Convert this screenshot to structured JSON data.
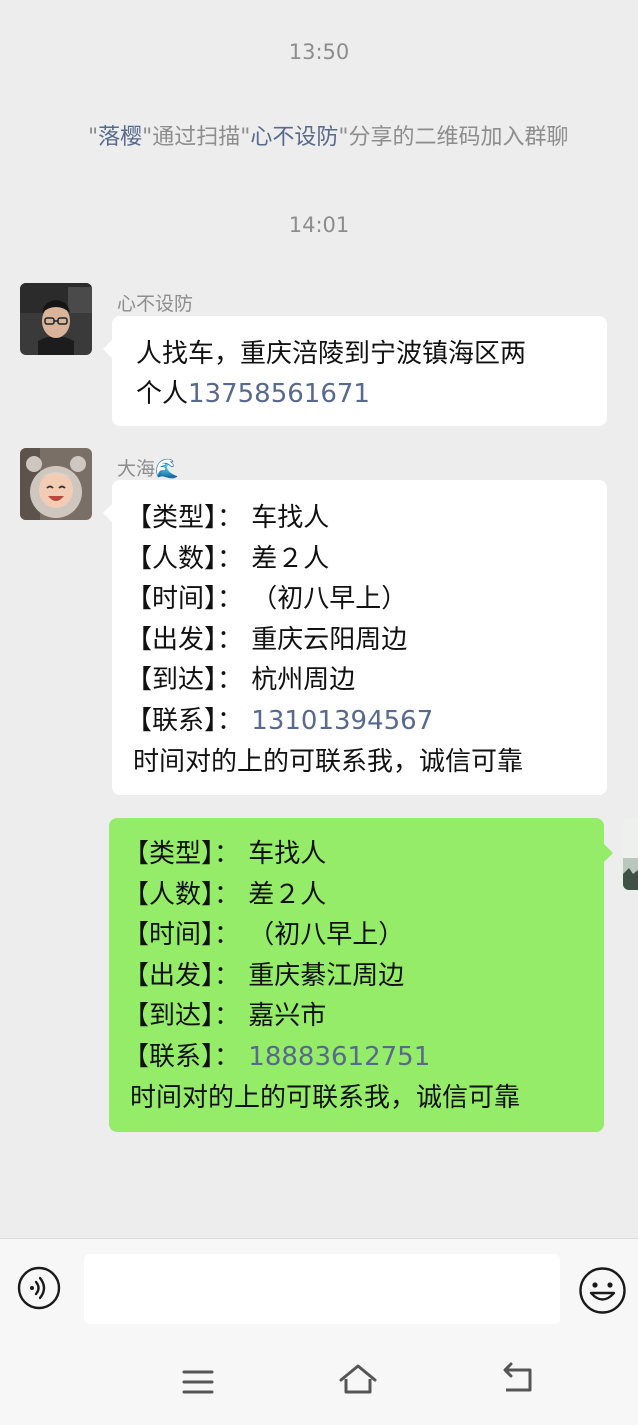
{
  "timestamps": [
    "13:50",
    "14:01"
  ],
  "system_message": {
    "q1": "\"",
    "name1": "落樱",
    "mid": "\"通过扫描\"",
    "name2": "心不设防",
    "tail": "\"分享的二维码加入群聊"
  },
  "messages": [
    {
      "sender": "心不设防",
      "avatar_icon": "man-avatar-photo",
      "line1": "人找车，重庆涪陵到宁波镇海区两",
      "line2_text": "个人",
      "phone": "13758561671"
    },
    {
      "sender": "大海🌊",
      "avatar_icon": "toddler-avatar-photo",
      "lines": [
        {
          "label": "【类型】：",
          "value": "车找人"
        },
        {
          "label": "【人数】：",
          "value": "差２人"
        },
        {
          "label": "【时间】：",
          "value": "（初八早上）"
        },
        {
          "label": "【出发】：",
          "value": "重庆云阳周边"
        },
        {
          "label": "【到达】：",
          "value": "杭州周边"
        },
        {
          "label": "【联系】：",
          "value": "13101394567"
        }
      ],
      "footer": "时间对的上的可联系我，诚信可靠"
    },
    {
      "sender": "me",
      "avatar_icon": "landscape-avatar-photo",
      "lines": [
        {
          "label": "【类型】：",
          "value": "车找人"
        },
        {
          "label": "【人数】：",
          "value": "差２人"
        },
        {
          "label": "【时间】：",
          "value": "（初八早上）"
        },
        {
          "label": "【出发】：",
          "value": "重庆綦江周边"
        },
        {
          "label": "【到达】：",
          "value": "嘉兴市"
        },
        {
          "label": "【联系】：",
          "value": "18883612751"
        }
      ],
      "footer": "时间对的上的可联系我，诚信可靠"
    }
  ],
  "input_bar": {
    "voice_icon": "voice-icon",
    "input_value": "",
    "emoji_icon": "emoji-icon"
  },
  "nav": [
    "menu-icon",
    "home-icon",
    "back-icon"
  ],
  "colors": {
    "background": "#ededed",
    "incoming_bubble": "#ffffff",
    "outgoing_bubble": "#95ec69",
    "link_blue": "#57698c",
    "meta_gray": "#8d8d8d"
  }
}
